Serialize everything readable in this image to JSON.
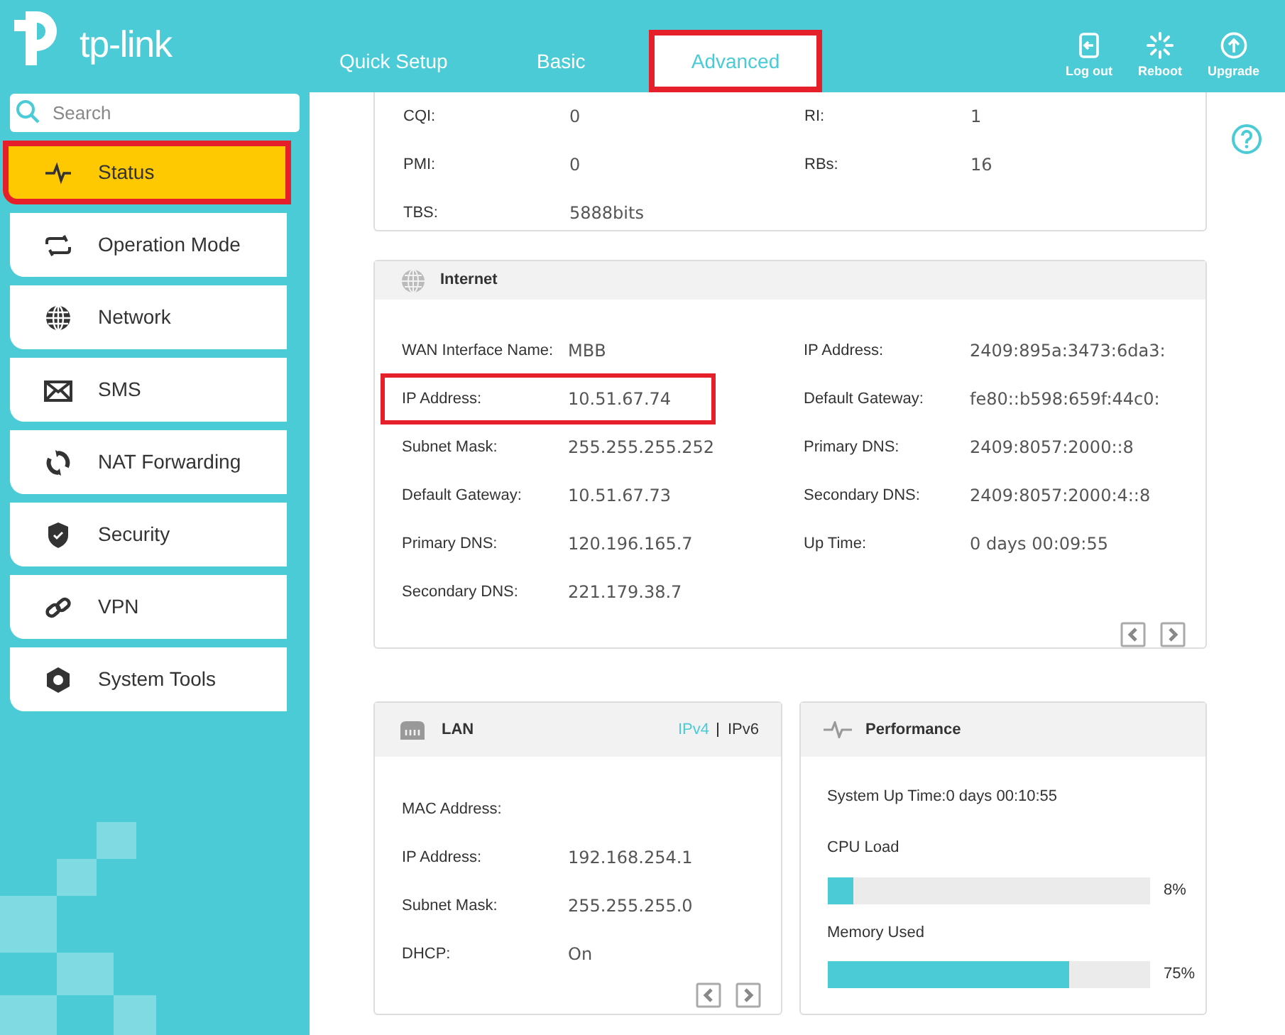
{
  "header": {
    "brand": "tp-link",
    "tabs": [
      {
        "label": "Quick Setup",
        "selected": false,
        "highlighted": false
      },
      {
        "label": "Basic",
        "selected": false,
        "highlighted": false
      },
      {
        "label": "Advanced",
        "selected": true,
        "highlighted": true
      }
    ],
    "actions": [
      {
        "kind": "logout",
        "label": "Log out"
      },
      {
        "kind": "reboot",
        "label": "Reboot"
      },
      {
        "kind": "upgrade",
        "label": "Upgrade"
      }
    ]
  },
  "sidebar": {
    "search": {
      "placeholder": "Search"
    },
    "items": [
      {
        "kind": "pulse",
        "label": "Status",
        "selected": true,
        "highlighted": true
      },
      {
        "kind": "mode",
        "label": "Operation Mode",
        "selected": false,
        "highlighted": false
      },
      {
        "kind": "globe",
        "label": "Network",
        "selected": false,
        "highlighted": false
      },
      {
        "kind": "mail",
        "label": "SMS",
        "selected": false,
        "highlighted": false
      },
      {
        "kind": "nat",
        "label": "NAT Forwarding",
        "selected": false,
        "highlighted": false
      },
      {
        "kind": "shield",
        "label": "Security",
        "selected": false,
        "highlighted": false
      },
      {
        "kind": "link",
        "label": "VPN",
        "selected": false,
        "highlighted": false
      },
      {
        "kind": "gear",
        "label": "System Tools",
        "selected": false,
        "highlighted": false
      }
    ]
  },
  "mobile_card": {
    "rows": [
      [
        {
          "label": "CQI:",
          "value": "0"
        },
        {
          "label": "RI:",
          "value": "1"
        }
      ],
      [
        {
          "label": "PMI:",
          "value": "0"
        },
        {
          "label": "RBs:",
          "value": "16"
        }
      ],
      [
        {
          "label": "TBS:",
          "value": "5888bits"
        }
      ]
    ]
  },
  "internet_card": {
    "title": "Internet",
    "left": [
      {
        "label": "WAN Interface Name:",
        "value": "MBB",
        "highlighted": false
      },
      {
        "label": "IP Address:",
        "value": "10.51.67.74",
        "highlighted": true
      },
      {
        "label": "Subnet Mask:",
        "value": "255.255.255.252",
        "highlighted": false
      },
      {
        "label": "Default Gateway:",
        "value": "10.51.67.73",
        "highlighted": false
      },
      {
        "label": "Primary DNS:",
        "value": "120.196.165.7",
        "highlighted": false
      },
      {
        "label": "Secondary DNS:",
        "value": "221.179.38.7",
        "highlighted": false
      }
    ],
    "right": [
      {
        "label": "IP Address:",
        "value": "2409:895a:3473:6da3:"
      },
      {
        "label": "Default Gateway:",
        "value": "fe80::b598:659f:44c0:"
      },
      {
        "label": "Primary DNS:",
        "value": "2409:8057:2000::8"
      },
      {
        "label": "Secondary DNS:",
        "value": "2409:8057:2000:4::8"
      },
      {
        "label": "Up Time:",
        "value": "0 days 00:09:55"
      }
    ]
  },
  "lan_card": {
    "title": "LAN",
    "versions": [
      {
        "label": "IPv4",
        "selected": true
      },
      {
        "label": "IPv6",
        "selected": false
      }
    ],
    "rows": [
      {
        "label": "MAC Address:"
      },
      {
        "label": "IP Address:",
        "value": "192.168.254.1"
      },
      {
        "label": "Subnet Mask:",
        "value": "255.255.255.0"
      },
      {
        "label": "DHCP:",
        "value": "On"
      }
    ]
  },
  "performance_card": {
    "title": "Performance",
    "uptime": "System Up Time:0 days 00:10:55",
    "meters": [
      {
        "label": "CPU Load",
        "level": 0.08,
        "reading": "8%"
      },
      {
        "label": "Memory Used",
        "level": 0.75,
        "reading": "75%"
      }
    ]
  }
}
